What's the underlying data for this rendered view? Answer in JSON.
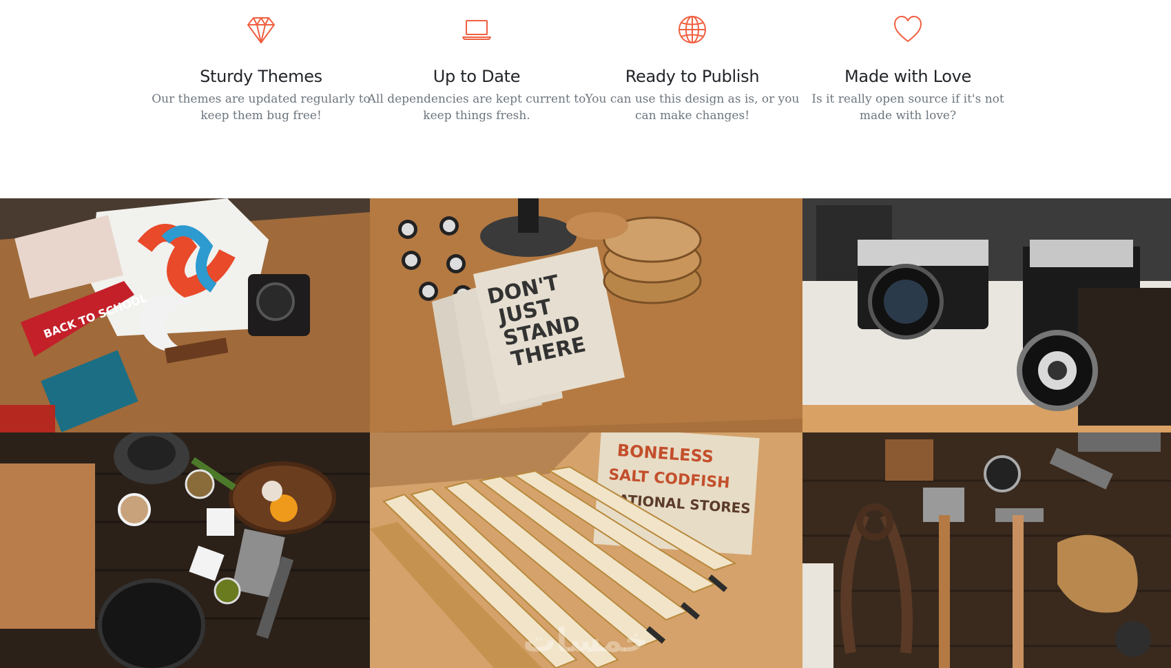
{
  "colors": {
    "accent": "#f05f40",
    "heading": "#212529",
    "muted": "#6c757d"
  },
  "features": [
    {
      "icon": "diamond-icon",
      "title": "Sturdy Themes",
      "text": "Our themes are updated regularly to keep them bug free!"
    },
    {
      "icon": "laptop-icon",
      "title": "Up to Date",
      "text": "All dependencies are kept current to keep things fresh."
    },
    {
      "icon": "globe-icon",
      "title": "Ready to Publish",
      "text": "You can use this design as is, or you can make changes!"
    },
    {
      "icon": "heart-icon",
      "title": "Made with Love",
      "text": "Is it really open source if it's not made with love?"
    }
  ],
  "gallery": {
    "items": [
      {
        "name": "portfolio-item-1",
        "description": "flat lay of t-shirt, vintage camera and ampersand on a wooden table"
      },
      {
        "name": "portfolio-item-2",
        "description": "notebooks reading DON'T JUST STAND THERE with wooden coasters"
      },
      {
        "name": "portfolio-item-3",
        "description": "vintage cameras on a wooden shelf"
      },
      {
        "name": "portfolio-item-4",
        "description": "kitchen flat lay with cutting board, mortar, cleaver and pan"
      },
      {
        "name": "portfolio-item-5",
        "description": "folding wooden rulers with a boneless salt codfish box"
      },
      {
        "name": "portfolio-item-6",
        "description": "old tools: axe, hammer, tongs and leather gloves"
      }
    ],
    "photo_text": {
      "pennant": "BACK TO SCHOOL",
      "notebook": [
        "DON'T",
        "JUST",
        "STAND",
        "THERE"
      ],
      "box_line1": "BONELESS",
      "box_line2": "SALT CODFISH",
      "box_line3": "NATIONAL STORES"
    }
  },
  "watermark": "خمسات"
}
